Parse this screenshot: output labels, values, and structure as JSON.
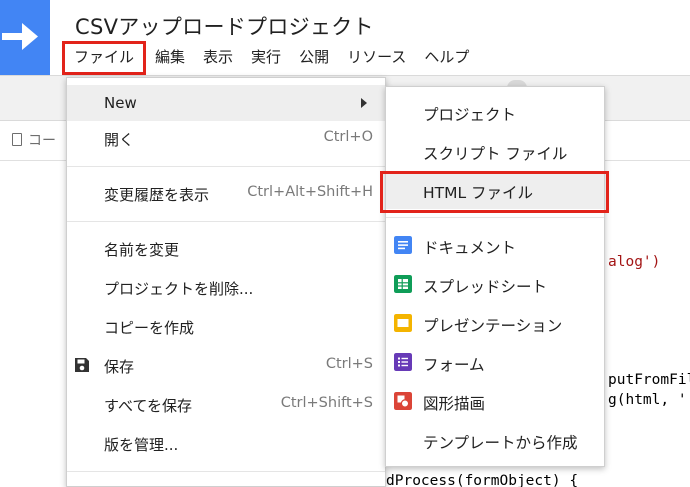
{
  "app": {
    "title": "CSVアップロードプロジェクト"
  },
  "menubar": {
    "items": [
      "ファイル",
      "編集",
      "表示",
      "実行",
      "公開",
      "リソース",
      "ヘルプ"
    ],
    "active": "ファイル"
  },
  "editor": {
    "file_tab": "コー",
    "code_lines": [
      "alog')",
      "putFromFil",
      "g(html, '",
      "dProcess(formObject) {"
    ]
  },
  "file_menu": {
    "items": [
      {
        "label": "New",
        "shortcut": "",
        "submenu": true,
        "highlighted": true
      },
      {
        "label": "開く",
        "shortcut": "Ctrl+O"
      },
      {
        "label": "変更履歴を表示",
        "shortcut": "Ctrl+Alt+Shift+H"
      },
      {
        "label": "名前を変更",
        "shortcut": ""
      },
      {
        "label": "プロジェクトを削除...",
        "shortcut": ""
      },
      {
        "label": "コピーを作成",
        "shortcut": ""
      },
      {
        "label": "保存",
        "shortcut": "Ctrl+S",
        "icon": "save-icon"
      },
      {
        "label": "すべてを保存",
        "shortcut": "Ctrl+Shift+S"
      },
      {
        "label": "版を管理...",
        "shortcut": ""
      }
    ]
  },
  "new_submenu": {
    "items": [
      {
        "label": "プロジェクト",
        "icon": ""
      },
      {
        "label": "スクリプト ファイル",
        "icon": ""
      },
      {
        "label": "HTML ファイル",
        "icon": "",
        "highlighted": true
      },
      {
        "label": "ドキュメント",
        "icon": "docs-icon",
        "color": "#4285f4"
      },
      {
        "label": "スプレッドシート",
        "icon": "sheets-icon",
        "color": "#0f9d58"
      },
      {
        "label": "プレゼンテーション",
        "icon": "slides-icon",
        "color": "#f4b400"
      },
      {
        "label": "フォーム",
        "icon": "forms-icon",
        "color": "#673ab7"
      },
      {
        "label": "図形描画",
        "icon": "drawings-icon",
        "color": "#db4437"
      },
      {
        "label": "テンプレートから作成",
        "icon": ""
      }
    ]
  },
  "colors": {
    "accent": "#4285f4",
    "highlight_outline": "#e2231a"
  }
}
